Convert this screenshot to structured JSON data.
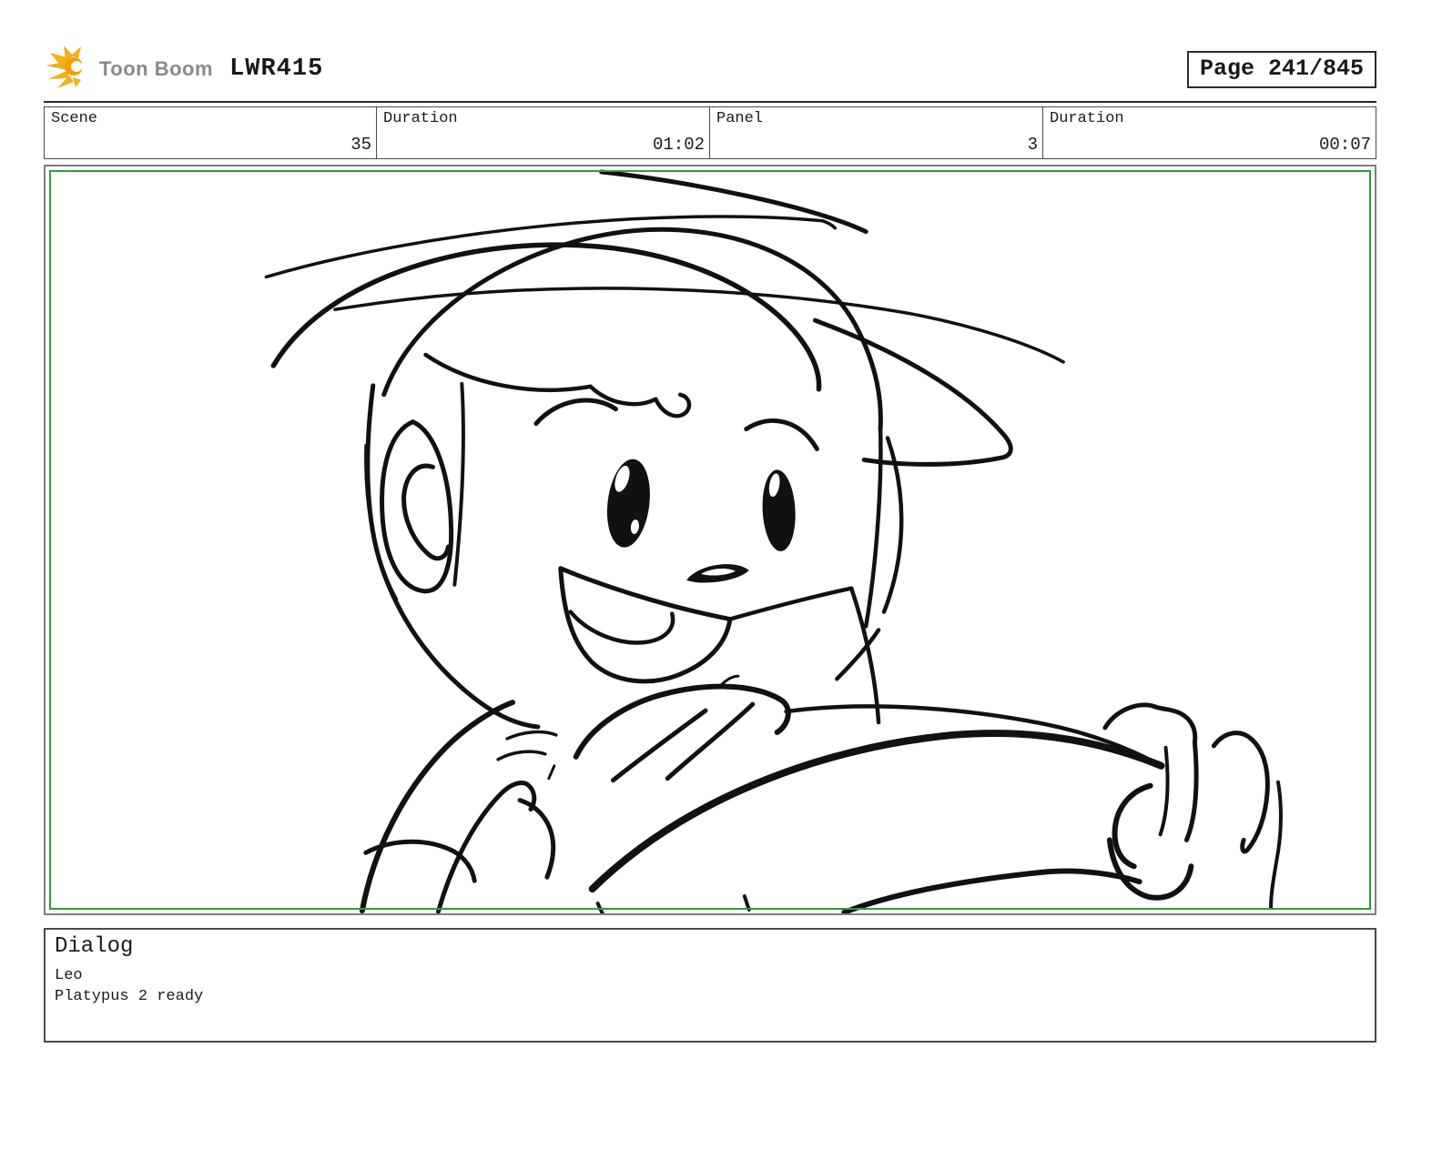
{
  "header": {
    "logo": {
      "brand": "Toon Boom",
      "icon": "starburst-icon"
    },
    "title": "LWR415",
    "page_label": "Page 241/845"
  },
  "info_row": {
    "cells": [
      {
        "label": "Scene",
        "value": "35"
      },
      {
        "label": "Duration",
        "value": "01:02"
      },
      {
        "label": "Panel",
        "value": "3"
      },
      {
        "label": "Duration",
        "value": "00:07"
      }
    ]
  },
  "panel": {
    "description": "rough black-line storyboard sketch: smiling child in a wide-brim hat, hand raised, gripping a steering wheel",
    "border_color": "#2e9b3c"
  },
  "dialog": {
    "heading": "Dialog",
    "character": "Leo",
    "line": "Platypus 2 ready"
  },
  "colors": {
    "ink": "#111111",
    "panel_green": "#2e9b3c",
    "logo_yellow": "#f2b01e",
    "logo_orange": "#f59f00",
    "logo_text_gray": "#8a8a8a"
  }
}
